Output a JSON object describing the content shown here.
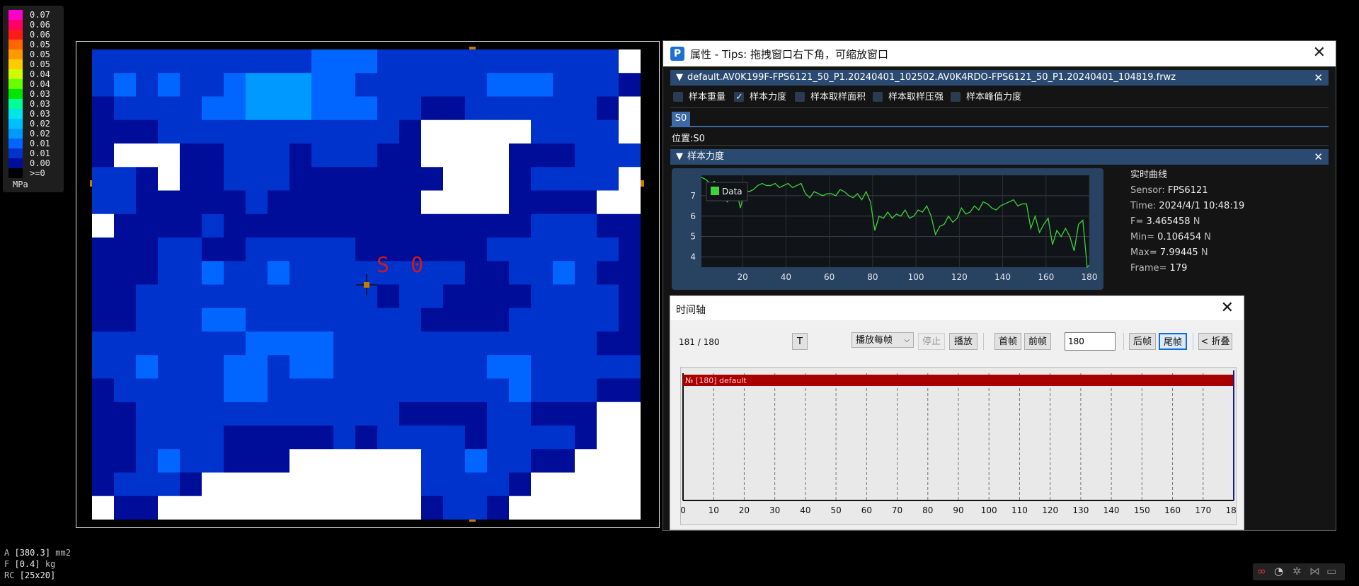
{
  "legend": {
    "items": [
      {
        "label": "0.07",
        "color": "#ff00cc"
      },
      {
        "label": "0.06",
        "color": "#ff0066"
      },
      {
        "label": "0.06",
        "color": "#ff1a1a"
      },
      {
        "label": "0.05",
        "color": "#ff6600"
      },
      {
        "label": "0.05",
        "color": "#ff9900"
      },
      {
        "label": "0.05",
        "color": "#ffcc00"
      },
      {
        "label": "0.04",
        "color": "#ccff00"
      },
      {
        "label": "0.04",
        "color": "#66ff00"
      },
      {
        "label": "0.03",
        "color": "#00e600"
      },
      {
        "label": "0.03",
        "color": "#00ff99"
      },
      {
        "label": "0.03",
        "color": "#00e5e5"
      },
      {
        "label": "0.02",
        "color": "#00bfff"
      },
      {
        "label": "0.02",
        "color": "#0099ff"
      },
      {
        "label": "0.01",
        "color": "#0066ff"
      },
      {
        "label": "0.01",
        "color": "#0033cc"
      },
      {
        "label": "0.00",
        "color": "#000d99"
      },
      {
        "label": ">=0",
        "color": "#000000"
      }
    ],
    "unit": "MPa"
  },
  "canvas": {
    "sample_label": "S 0"
  },
  "status": {
    "area_prefix": "A",
    "area_value": "[380.3]",
    "area_unit": "mm2",
    "force_prefix": "F",
    "force_value": "[0.4]",
    "force_unit": "kg",
    "rc_prefix": "RC",
    "rc_value": "[25x20]"
  },
  "property_window": {
    "title": "属性 - Tips: 拖拽窗口右下角，可缩放窗口",
    "app_icon": "P",
    "file_section": "default.AV0K199F-FPS6121_50_P1.20240401_102502.AV0K4RDO-FPS6121_50_P1.20240401_104819.frwz",
    "checkboxes": [
      {
        "label": "样本重量",
        "checked": false
      },
      {
        "label": "样本力度",
        "checked": true
      },
      {
        "label": "样本取样面积",
        "checked": false
      },
      {
        "label": "样本取样压强",
        "checked": false
      },
      {
        "label": "样本峰值力度",
        "checked": false
      }
    ],
    "tab": "S0",
    "position": "位置:S0",
    "force_section": "样本力度",
    "realtime": {
      "heading": "实时曲线",
      "sensor_label": "Sensor:",
      "sensor": "FPS6121",
      "time_label": "Time:",
      "time": "2024/4/1 10:48:19",
      "f_label": "F=",
      "f": "3.465458",
      "f_unit": "N",
      "min_label": "Min=",
      "min": "0.106454",
      "min_unit": "N",
      "max_label": "Max=",
      "max": "7.99445",
      "max_unit": "N",
      "frame_label": "Frame=",
      "frame": "179"
    }
  },
  "chart_data": {
    "type": "line",
    "title": "",
    "xlabel": "",
    "ylabel": "",
    "xlim": [
      1,
      180
    ],
    "ylim": [
      3.5,
      8.0
    ],
    "xticks": [
      20,
      40,
      60,
      80,
      100,
      120,
      140,
      160,
      180
    ],
    "yticks": [
      4,
      5,
      6,
      7
    ],
    "grid": true,
    "legend_position": "top-left",
    "series": [
      {
        "name": "Data",
        "color": "#3cd23c",
        "x": [
          1,
          3,
          5,
          7,
          9,
          11,
          13,
          15,
          17,
          19,
          21,
          23,
          25,
          27,
          29,
          31,
          33,
          35,
          37,
          39,
          41,
          43,
          45,
          47,
          49,
          51,
          53,
          55,
          57,
          59,
          61,
          63,
          65,
          67,
          69,
          71,
          73,
          75,
          77,
          79,
          81,
          83,
          85,
          87,
          89,
          91,
          93,
          95,
          97,
          99,
          101,
          103,
          105,
          107,
          109,
          111,
          113,
          115,
          117,
          119,
          121,
          123,
          125,
          127,
          129,
          131,
          133,
          135,
          137,
          139,
          141,
          143,
          145,
          147,
          149,
          151,
          153,
          155,
          157,
          159,
          161,
          163,
          165,
          167,
          169,
          171,
          173,
          175,
          177,
          179,
          180
        ],
        "y": [
          7.9,
          7.8,
          7.6,
          7.7,
          7.2,
          6.9,
          6.7,
          7.4,
          7.3,
          6.4,
          7.3,
          7.2,
          7.3,
          7.5,
          7.6,
          7.5,
          7.5,
          7.6,
          7.4,
          7.5,
          7.6,
          7.4,
          7.5,
          7.6,
          7.1,
          6.9,
          7.2,
          7.1,
          7.0,
          7.1,
          7.1,
          7.0,
          7.3,
          7.2,
          7.0,
          6.9,
          7.1,
          6.8,
          7.2,
          6.7,
          5.3,
          6.0,
          5.9,
          6.2,
          5.9,
          6.1,
          6.0,
          6.3,
          5.9,
          6.0,
          6.3,
          6.2,
          6.5,
          6.0,
          5.1,
          5.5,
          5.6,
          6.0,
          5.7,
          5.9,
          6.4,
          6.1,
          6.2,
          6.5,
          6.3,
          6.7,
          6.6,
          6.4,
          6.3,
          6.5,
          6.6,
          6.7,
          6.8,
          6.5,
          6.6,
          6.6,
          5.4,
          6.0,
          5.2,
          5.6,
          5.9,
          4.6,
          5.3,
          5.0,
          5.4,
          5.0,
          4.3,
          5.6,
          5.8,
          3.5,
          3.6
        ]
      }
    ]
  },
  "timeline": {
    "title": "时间轴",
    "frame_count": "181 / 180",
    "t_button": "T",
    "play_mode": "播放每帧",
    "stop": "停止",
    "play": "播放",
    "first": "首帧",
    "prev": "前帧",
    "frame_value": "180",
    "next": "后帧",
    "last": "尾帧",
    "collapse": "< 折叠",
    "track_label": "№ [180] default",
    "ticks": [
      "0",
      "10",
      "20",
      "30",
      "40",
      "50",
      "60",
      "70",
      "80",
      "90",
      "100",
      "110",
      "120",
      "130",
      "140",
      "150",
      "160",
      "170",
      "180"
    ]
  },
  "heatmap_data": {
    "rows": 20,
    "cols": 25,
    "levels": [
      "#ffffff",
      "#000d99",
      "#0033cc",
      "#0066ff",
      "#0099ff",
      "#00bfff",
      "#00e5e5"
    ],
    "cells": [
      "2222222222333222222222220",
      "2323223444332222223332221",
      "1222233444333221122222210",
      "1112222222222210000022220",
      "1000112221222110000111222",
      "2210112221111111000122220",
      "2211111211111110000111100",
      "0111121111111111111122211",
      "1112211222221111112222221",
      "1112232232222222211223211",
      "1122222222222122111122221",
      "1122233222222221111222221",
      "2222222333322222222222211",
      "2232223323322222223322222",
      "1222223322222222222322211",
      "1122222222222211112211100",
      "1122221111121222212222100",
      "1123221110000002232211000",
      "1222100000000002222100000",
      "0110000000000001221000000"
    ]
  }
}
